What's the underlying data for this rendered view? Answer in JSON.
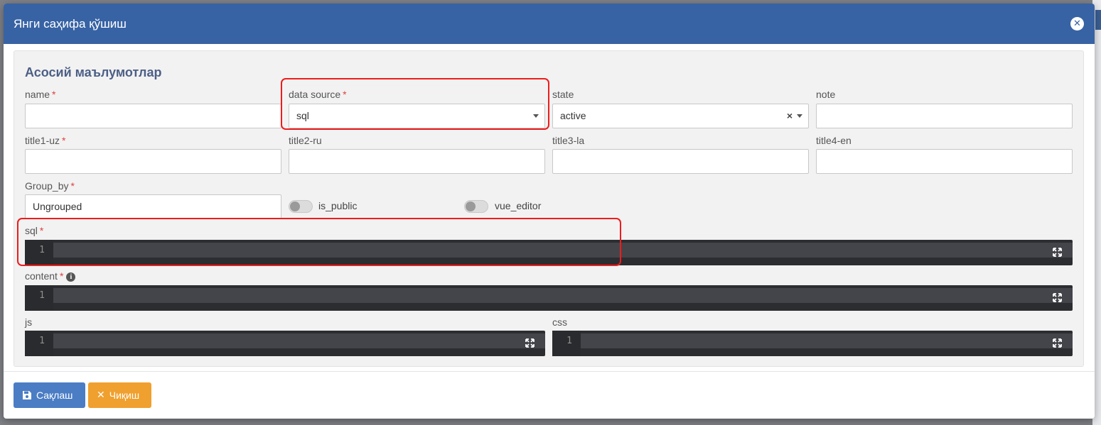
{
  "modal": {
    "title": "Янги саҳифа қўшиш",
    "close_icon": "close-circle-icon"
  },
  "section": {
    "title": "Асосий маълумотлар"
  },
  "fields": {
    "name": {
      "label": "name",
      "required": "*",
      "value": ""
    },
    "data_source": {
      "label": "data source",
      "required": "*",
      "value": "sql"
    },
    "state": {
      "label": "state",
      "value": "active",
      "clear": "×"
    },
    "note": {
      "label": "note",
      "value": ""
    },
    "title1": {
      "label": "title1-uz",
      "required": "*",
      "value": ""
    },
    "title2": {
      "label": "title2-ru",
      "value": ""
    },
    "title3": {
      "label": "title3-la",
      "value": ""
    },
    "title4": {
      "label": "title4-en",
      "value": ""
    },
    "group_by": {
      "label": "Group_by",
      "required": "*",
      "value": "Ungrouped"
    },
    "is_public": {
      "label": "is_public",
      "checked": false
    },
    "vue_editor": {
      "label": "vue_editor",
      "checked": false
    },
    "sql": {
      "label": "sql",
      "required": "*",
      "line": "1"
    },
    "content": {
      "label": "content",
      "required": "*",
      "info": "i",
      "line": "1"
    },
    "js": {
      "label": "js",
      "line": "1"
    },
    "css": {
      "label": "css",
      "line": "1"
    }
  },
  "footer": {
    "save_label": "Сақлаш",
    "save_icon": "floppy-disk-icon",
    "exit_label": "Чиқиш",
    "exit_icon": "x-icon"
  },
  "colors": {
    "header": "#3763a4",
    "save": "#4b7dc4",
    "exit": "#f0a02e",
    "highlight": "#ee1c1c"
  }
}
